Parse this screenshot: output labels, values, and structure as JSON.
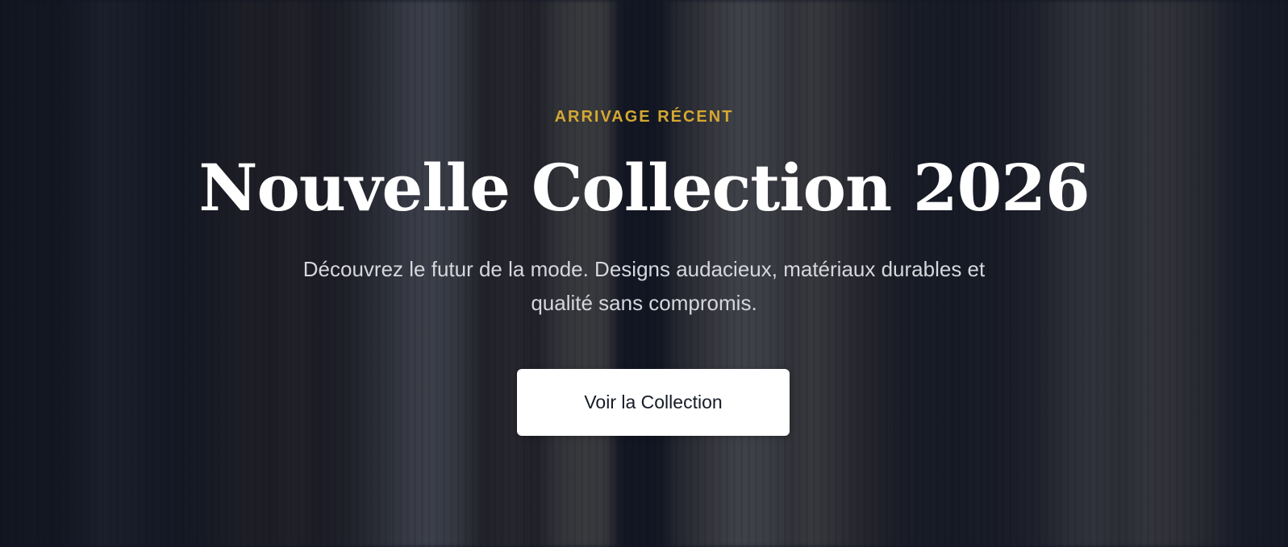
{
  "hero": {
    "eyebrow": "ARRIVAGE RÉCENT",
    "title": "Nouvelle Collection 2026",
    "subtitle": "Découvrez le futur de la mode. Designs audacieux, matériaux durables et qualité sans compromis.",
    "cta_label": "Voir la Collection",
    "background_image": "clothing-rack-photo"
  },
  "colors": {
    "accent": "#d4a832",
    "overlay": "#111624",
    "title": "#ffffff",
    "subtitle": "#d5d7dd",
    "button_bg": "#ffffff",
    "button_text": "#161b26"
  }
}
